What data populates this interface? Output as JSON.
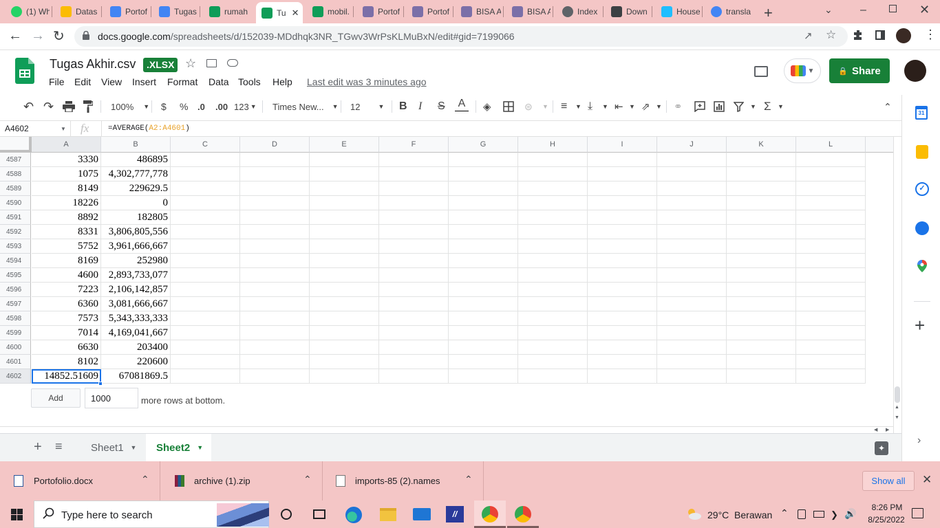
{
  "browser": {
    "tabs": [
      {
        "label": "(1) Wh",
        "icon": "whatsapp-icon",
        "color": "#25d366"
      },
      {
        "label": "Datas",
        "icon": "drive-icon",
        "color": "#fbbc04"
      },
      {
        "label": "Portof",
        "icon": "docs-icon",
        "color": "#4285f4"
      },
      {
        "label": "Tugas",
        "icon": "docs-icon",
        "color": "#4285f4"
      },
      {
        "label": "rumah",
        "icon": "sheets-icon",
        "color": "#0f9d58"
      },
      {
        "label": "Tu",
        "icon": "sheets-icon",
        "color": "#0f9d58",
        "active": true
      },
      {
        "label": "mobil.",
        "icon": "sheets-icon",
        "color": "#0f9d58"
      },
      {
        "label": "Portof",
        "icon": "site-icon",
        "color": "#7b6fa8"
      },
      {
        "label": "Portof",
        "icon": "site-icon",
        "color": "#7b6fa8"
      },
      {
        "label": "BISA A",
        "icon": "site-icon",
        "color": "#7b6fa8"
      },
      {
        "label": "BISA A",
        "icon": "site-icon",
        "color": "#7b6fa8"
      },
      {
        "label": "Index",
        "icon": "globe-icon",
        "color": "#5f6368"
      },
      {
        "label": "Down",
        "icon": "download-icon",
        "color": "#3c4043"
      },
      {
        "label": "House",
        "icon": "kaggle-icon",
        "color": "#20beff"
      },
      {
        "label": "transla",
        "icon": "google-icon",
        "color": "#4285f4"
      }
    ],
    "url_host": "docs.google.com",
    "url_path": "/spreadsheets/d/152039-MDdhqk3NR_TGwv3WrPsKLMuBxN/edit#gid=7199066"
  },
  "doc": {
    "title": "Tugas Akhir.csv",
    "badge": ".XLSX",
    "last_edit": "Last edit was 3 minutes ago",
    "share_label": "Share",
    "menus": [
      "File",
      "Edit",
      "View",
      "Insert",
      "Format",
      "Data",
      "Tools",
      "Help"
    ]
  },
  "toolbar": {
    "zoom": "100%",
    "currency": "$",
    "percent": "%",
    "dec_decrease": ".0",
    "dec_increase": ".00",
    "number_format": "123",
    "font": "Times New...",
    "font_size": "12",
    "bold": "B",
    "italic": "I",
    "strike": "S",
    "text_color": "A",
    "sum": "Σ"
  },
  "formula": {
    "cell_ref": "A4602",
    "fx": "fx",
    "formula_prefix": "=AVERAGE(",
    "formula_range": "A2:A4601",
    "formula_suffix": ")"
  },
  "grid": {
    "columns": [
      "A",
      "B",
      "C",
      "D",
      "E",
      "F",
      "G",
      "H",
      "I",
      "J",
      "K",
      "L"
    ],
    "rows": [
      {
        "n": "4587",
        "a": "3330",
        "b": "486895"
      },
      {
        "n": "4588",
        "a": "1075",
        "b": "4,302,777,778"
      },
      {
        "n": "4589",
        "a": "8149",
        "b": "229629.5"
      },
      {
        "n": "4590",
        "a": "18226",
        "b": "0"
      },
      {
        "n": "4591",
        "a": "8892",
        "b": "182805"
      },
      {
        "n": "4592",
        "a": "8331",
        "b": "3,806,805,556"
      },
      {
        "n": "4593",
        "a": "5752",
        "b": "3,961,666,667"
      },
      {
        "n": "4594",
        "a": "8169",
        "b": "252980"
      },
      {
        "n": "4595",
        "a": "4600",
        "b": "2,893,733,077"
      },
      {
        "n": "4596",
        "a": "7223",
        "b": "2,106,142,857"
      },
      {
        "n": "4597",
        "a": "6360",
        "b": "3,081,666,667"
      },
      {
        "n": "4598",
        "a": "7573",
        "b": "5,343,333,333"
      },
      {
        "n": "4599",
        "a": "7014",
        "b": "4,169,041,667"
      },
      {
        "n": "4600",
        "a": "6630",
        "b": "203400"
      },
      {
        "n": "4601",
        "a": "8102",
        "b": "220600"
      },
      {
        "n": "4602",
        "a": "14852.51609",
        "b": "67081869.5"
      }
    ],
    "add_label": "Add",
    "add_rows_value": "1000",
    "add_rows_suffix": "more rows at bottom."
  },
  "sheets": {
    "tabs": [
      {
        "label": "Sheet1",
        "active": false
      },
      {
        "label": "Sheet2",
        "active": true
      }
    ]
  },
  "downloads": {
    "items": [
      {
        "label": "Portofolio.docx",
        "icon": "word-icon"
      },
      {
        "label": "archive (1).zip",
        "icon": "winrar-icon"
      },
      {
        "label": "imports-85 (2).names",
        "icon": "file-icon"
      }
    ],
    "show_all": "Show all"
  },
  "taskbar": {
    "search_placeholder": "Type here to search",
    "weather": "29°C  Berawan",
    "time": "8:26 PM",
    "date": "8/25/2022"
  },
  "colors": {
    "chrome_pink": "#f4c6c6",
    "sheets_green": "#0f9d58",
    "share_green": "#188038",
    "selection_blue": "#1a73e8"
  }
}
